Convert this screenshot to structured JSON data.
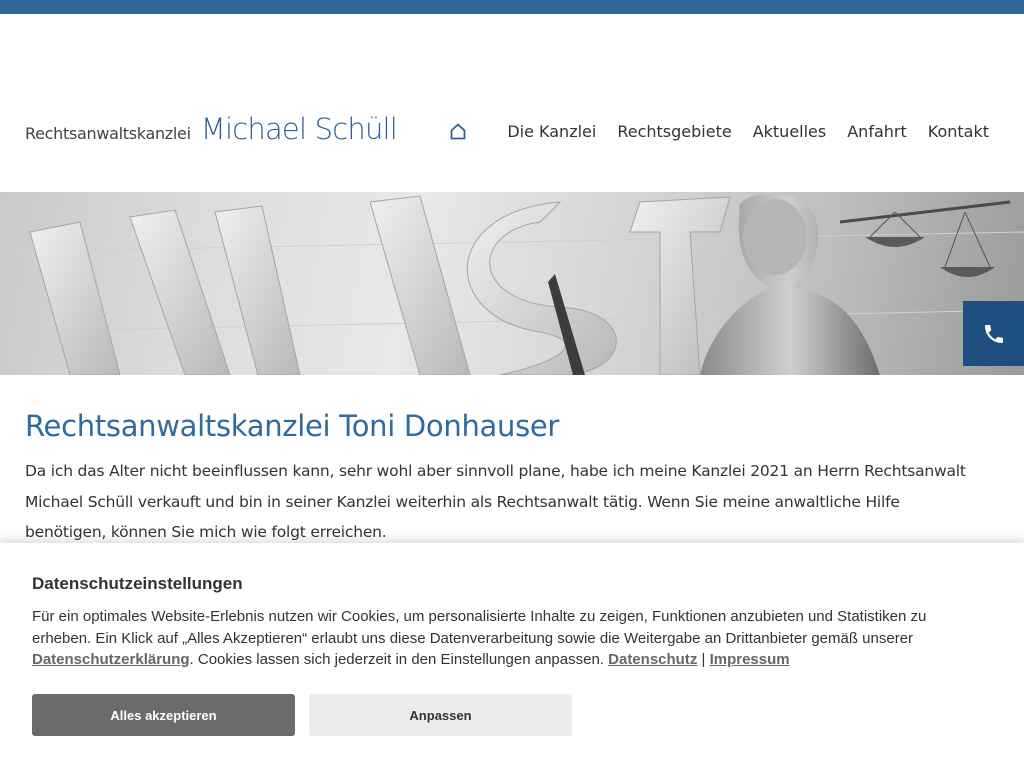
{
  "colors": {
    "top_bar": "#336699",
    "brand": "#2f5f93",
    "heading": "#2f6aa0",
    "phone_button": "#1f4e80",
    "accept_button": "#6b6b6b",
    "adjust_button": "#ececec"
  },
  "header": {
    "logo_prefix": "Rechtsanwaltskanzlei",
    "logo_name": "Michael Schüll",
    "home_icon": "home-icon",
    "nav": [
      "Die Kanzlei",
      "Rechtsgebiete",
      "Aktuelles",
      "Anfahrt",
      "Kontakt"
    ]
  },
  "hero": {
    "phone_icon": "phone-icon"
  },
  "main": {
    "title": "Rechtsanwaltskanzlei Toni Donhauser",
    "paragraph": "Da ich das Alter nicht beeinflussen kann, sehr wohl aber sinnvoll plane, habe ich meine Kanzlei 2021 an Herrn Rechtsanwalt Michael Schüll verkauft und bin in seiner Kanzlei weiterhin als Rechtsanwalt tätig. Wenn Sie meine anwaltliche Hilfe benötigen, können Sie mich wie folgt erreichen."
  },
  "cookie": {
    "title": "Datenschutzeinstellungen",
    "text_1": "Für ein optimales Website-Erlebnis nutzen wir Cookies, um personalisierte Inhalte zu zeigen, Funktionen anzubieten und Statistiken zu erheben. Ein Klick auf „Alles Akzeptieren“ erlaubt uns diese Datenverarbeitung sowie die Weitergabe an Drittanbieter gemäß unserer ",
    "link_privacy_statement": "Datenschutzerklärung",
    "text_2": ". Cookies lassen sich jederzeit in den Einstellungen anpassen. ",
    "link_privacy": "Datenschutz",
    "separator": " | ",
    "link_imprint": "Impressum",
    "accept_label": "Alles akzeptieren",
    "adjust_label": "Anpassen"
  }
}
